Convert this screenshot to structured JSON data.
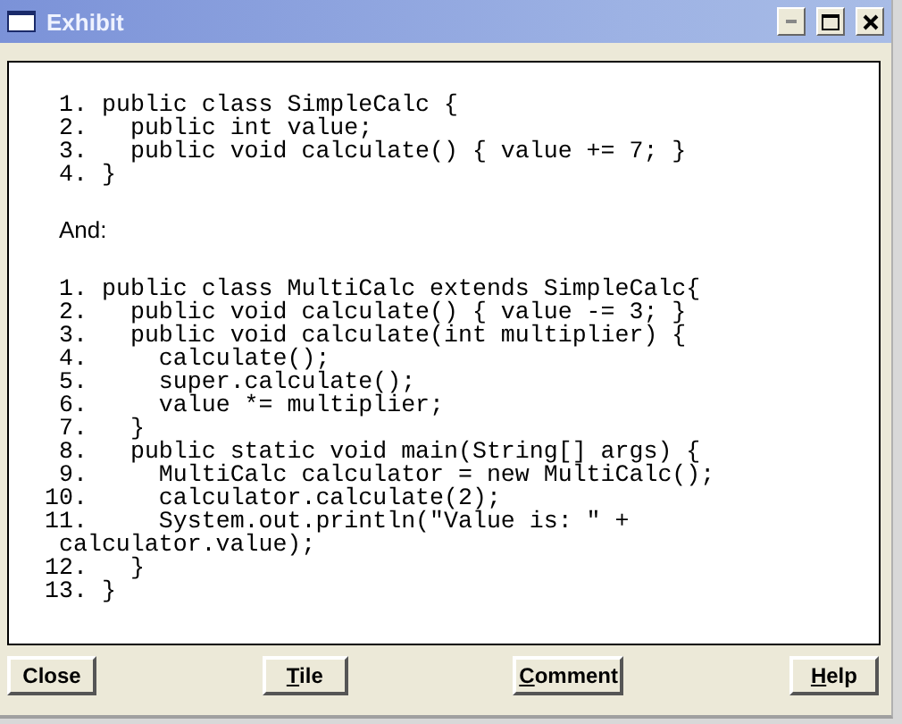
{
  "window": {
    "title": "Exhibit"
  },
  "listings": [
    {
      "lines": [
        {
          "kind": "numbered",
          "number": "1.",
          "code": "public class SimpleCalc {"
        },
        {
          "kind": "numbered",
          "number": "2.",
          "code": "  public int value;"
        },
        {
          "kind": "numbered",
          "number": "3.",
          "code": "  public void calculate() { value += 7; }"
        },
        {
          "kind": "numbered",
          "number": "4.",
          "code": "}"
        }
      ]
    },
    {
      "lines": [
        {
          "kind": "numbered",
          "number": "1.",
          "code": "public class MultiCalc extends SimpleCalc{"
        },
        {
          "kind": "numbered",
          "number": "2.",
          "code": "  public void calculate() { value -= 3; }"
        },
        {
          "kind": "numbered",
          "number": "3.",
          "code": "  public void calculate(int multiplier) {"
        },
        {
          "kind": "numbered",
          "number": "4.",
          "code": "    calculate();"
        },
        {
          "kind": "numbered",
          "number": "5.",
          "code": "    super.calculate();"
        },
        {
          "kind": "numbered",
          "number": "6.",
          "code": "    value *= multiplier;"
        },
        {
          "kind": "numbered",
          "number": "7.",
          "code": "  }"
        },
        {
          "kind": "numbered",
          "number": "8.",
          "code": "  public static void main(String[] args) {"
        },
        {
          "kind": "numbered",
          "number": "9.",
          "code": "    MultiCalc calculator = new MultiCalc();"
        },
        {
          "kind": "numbered",
          "number": "10.",
          "code": "    calculator.calculate(2);"
        },
        {
          "kind": "numbered",
          "number": "11.",
          "code": "    System.out.println(\"Value is: \" +"
        },
        {
          "kind": "wrap",
          "code": "calculator.value);"
        },
        {
          "kind": "numbered",
          "number": "12.",
          "code": "  }"
        },
        {
          "kind": "numbered",
          "number": "13.",
          "code": "}"
        }
      ]
    }
  ],
  "separator_text": "And:",
  "buttons": [
    {
      "label": "Close",
      "mnemonic": false
    },
    {
      "label": "Tile",
      "mnemonic": true
    },
    {
      "label": "Comment",
      "mnemonic": true
    },
    {
      "label": "Help",
      "mnemonic": true
    }
  ]
}
